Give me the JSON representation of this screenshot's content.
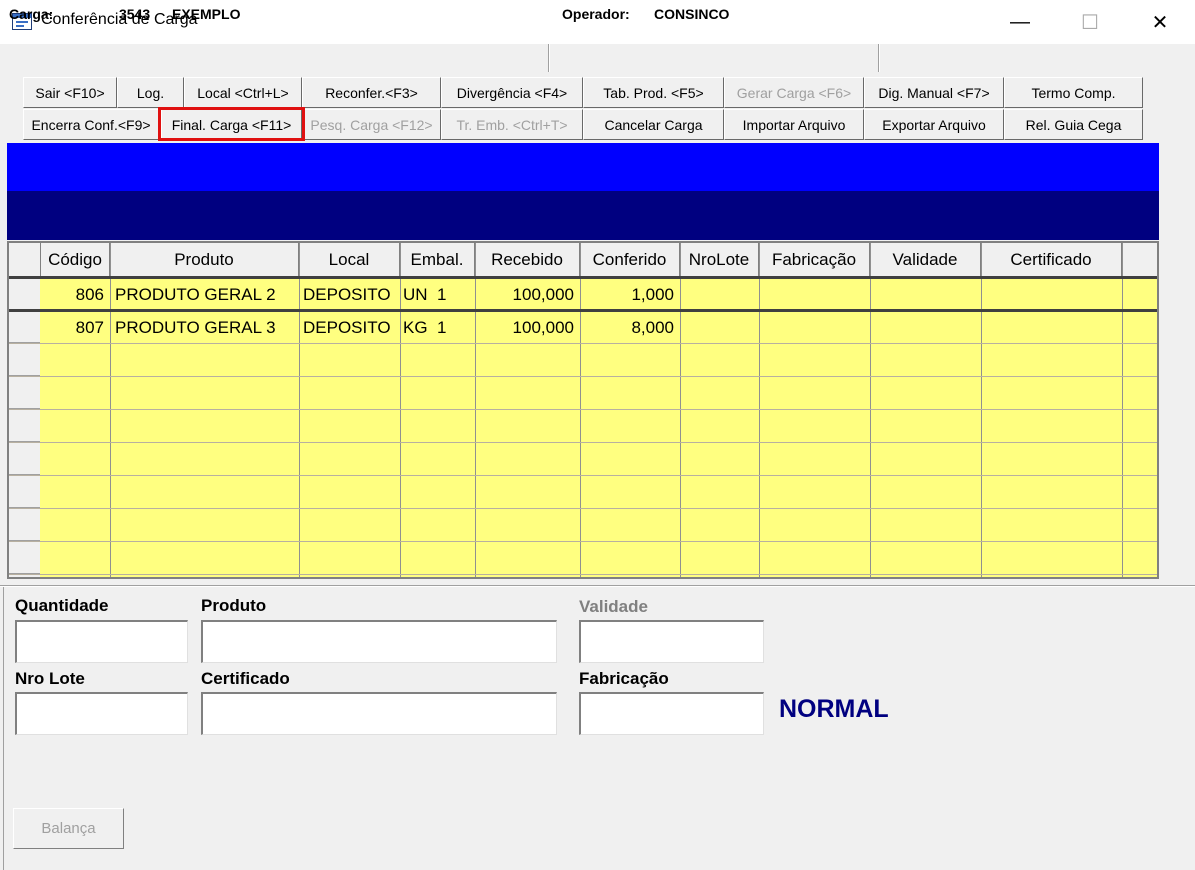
{
  "window": {
    "title": "Conferência de Carga",
    "minimize_glyph": "—",
    "maximize_glyph": "☐",
    "close_glyph": "✕"
  },
  "info": {
    "carga_label": "Carga:",
    "carga_number": "3543",
    "carga_name": "EXEMPLO",
    "operador_label": "Operador:",
    "operador_value": "CONSINCO"
  },
  "toolbar": {
    "row1": [
      {
        "label": "Sair <F10>",
        "enabled": true
      },
      {
        "label": "Log.",
        "enabled": true
      },
      {
        "label": "Local <Ctrl+L>",
        "enabled": true
      },
      {
        "label": "Reconfer.<F3>",
        "enabled": true
      },
      {
        "label": "Divergência <F4>",
        "enabled": true
      },
      {
        "label": "Tab. Prod. <F5>",
        "enabled": true
      },
      {
        "label": "Gerar Carga <F6>",
        "enabled": false
      },
      {
        "label": "Dig. Manual <F7>",
        "enabled": true
      },
      {
        "label": "Termo Comp.",
        "enabled": true
      }
    ],
    "row2": [
      {
        "label": "Encerra Conf.<F9>",
        "enabled": true
      },
      {
        "label": "Final. Carga <F11>",
        "enabled": true
      },
      {
        "label": "Pesq. Carga <F12>",
        "enabled": false
      },
      {
        "label": "Tr. Emb. <Ctrl+T>",
        "enabled": false
      },
      {
        "label": "Cancelar Carga",
        "enabled": true
      },
      {
        "label": "Importar Arquivo",
        "enabled": true
      },
      {
        "label": "Exportar Arquivo",
        "enabled": true
      },
      {
        "label": "Rel. Guia Cega",
        "enabled": true
      }
    ]
  },
  "grid": {
    "columns": [
      "Código",
      "Produto",
      "Local",
      "Embal.",
      "Recebido",
      "Conferido",
      "NroLote",
      "Fabricação",
      "Validade",
      "Certificado"
    ],
    "rows": [
      {
        "codigo": "806",
        "produto": "PRODUTO GERAL 2",
        "local": "DEPOSITO",
        "embal": "UN  1",
        "recebido": "100,000",
        "conferido": "1,000",
        "nrolote": "",
        "fabricacao": "",
        "validade": "",
        "certificado": ""
      },
      {
        "codigo": "807",
        "produto": "PRODUTO GERAL 3",
        "local": "DEPOSITO",
        "embal": "KG  1",
        "recebido": "100,000",
        "conferido": "8,000",
        "nrolote": "",
        "fabricacao": "",
        "validade": "",
        "certificado": ""
      }
    ]
  },
  "form": {
    "quantidade_label": "Quantidade",
    "produto_label": "Produto",
    "validade_label": "Validade",
    "nrolote_label": "Nro Lote",
    "certificado_label": "Certificado",
    "fabricacao_label": "Fabricação",
    "quantidade_value": "",
    "produto_value": "",
    "validade_value": "",
    "nrolote_value": "",
    "certificado_value": "",
    "fabricacao_value": "",
    "status": "NORMAL",
    "balanca_label": "Balança"
  },
  "colors": {
    "grid_background": "#ffff80",
    "blue_top": "#0000ff",
    "blue_bottom": "#000080",
    "status_text": "#000080",
    "highlight": "#e01010",
    "disabled_text": "#a0a0a0"
  }
}
